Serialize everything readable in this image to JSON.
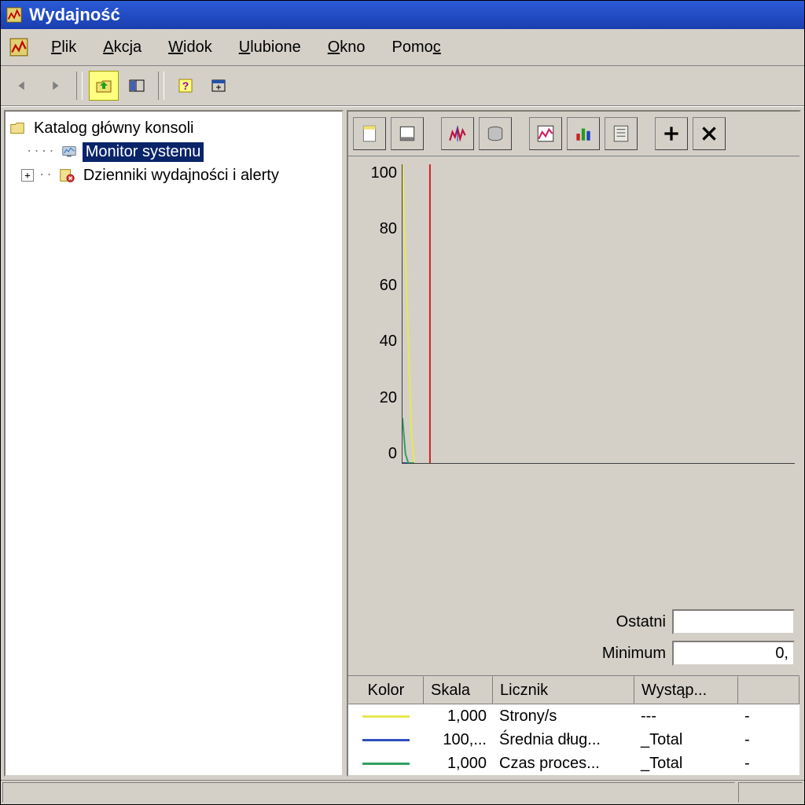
{
  "window": {
    "title": "Wydajność"
  },
  "menu": {
    "items": [
      {
        "label": "Plik",
        "ul": "P"
      },
      {
        "label": "Akcja",
        "ul": "A"
      },
      {
        "label": "Widok",
        "ul": "W"
      },
      {
        "label": "Ulubione",
        "ul": "U"
      },
      {
        "label": "Okno",
        "ul": "O"
      },
      {
        "label": "Pomoc",
        "ul": "c"
      }
    ]
  },
  "tree": {
    "root": "Katalog główny konsoli",
    "nodes": [
      {
        "label": "Monitor systemu",
        "selected": true
      },
      {
        "label": "Dzienniki wydajności i alerty",
        "selected": false,
        "expandable": true
      }
    ]
  },
  "readouts": {
    "ostatni_label": "Ostatni",
    "ostatni_value": "",
    "minimum_label": "Minimum",
    "minimum_value": "0,"
  },
  "counter_table": {
    "headers": [
      "Kolor",
      "Skala",
      "Licznik",
      "Wystąp..."
    ],
    "rows": [
      {
        "color": "#e8e850",
        "skala": "1,000",
        "licznik": "Strony/s",
        "wyst": "---"
      },
      {
        "color": "#3050c0",
        "skala": "100,...",
        "licznik": "Średnia dług...",
        "wyst": "_Total"
      },
      {
        "color": "#30a060",
        "skala": "1,000",
        "licznik": "Czas proces...",
        "wyst": "_Total"
      }
    ]
  },
  "chart_data": {
    "type": "line",
    "title": "",
    "xlabel": "",
    "ylabel": "",
    "ylim": [
      0,
      100
    ],
    "yticks": [
      0,
      20,
      40,
      60,
      80,
      100
    ],
    "x": [
      0,
      1,
      2,
      3,
      4,
      5,
      6,
      7,
      8
    ],
    "series": [
      {
        "name": "Strony/s",
        "color": "#e8e850",
        "values": [
          100,
          70,
          40,
          10,
          0,
          null,
          null,
          null,
          null
        ]
      },
      {
        "name": "Średnia dług...",
        "color": "#3050c0",
        "values": [
          0,
          0,
          0,
          0,
          0,
          null,
          null,
          null,
          null
        ]
      },
      {
        "name": "Czas proces...",
        "color": "#30a060",
        "values": [
          15,
          3,
          0,
          0,
          0,
          null,
          null,
          null,
          null
        ]
      },
      {
        "name": "cursor",
        "color": "#d02020",
        "values": [
          100,
          100,
          100,
          100,
          100,
          null,
          null,
          null,
          null
        ]
      }
    ]
  }
}
